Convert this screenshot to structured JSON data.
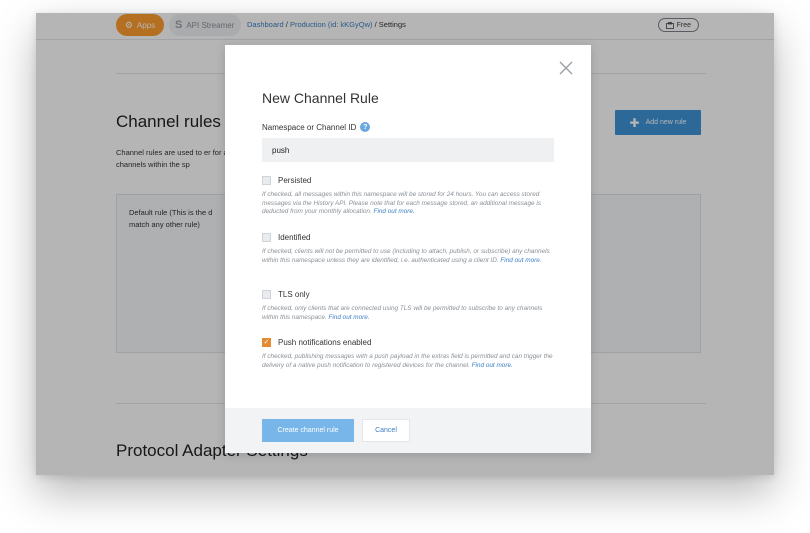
{
  "topbar": {
    "apps_label": "Apps",
    "streamer_icon": "S",
    "streamer_label": "API Streamer",
    "breadcrumb": {
      "dashboard": "Dashboard",
      "sep1": " / ",
      "app": "Production (id: kKGyQw)",
      "sep2": " / ",
      "current": "Settings"
    },
    "plan_label": "Free"
  },
  "page": {
    "channel_rules_title": "Channel rules",
    "channel_rules_desc": "Channel rules are used to er for all channels within the sp",
    "add_rule_label": "Add new rule",
    "default_rule_text": "Default rule (This is the d match any other rule)",
    "protocol_title": "Protocol Adapter Settings"
  },
  "modal": {
    "title": "New Channel Rule",
    "namespace_label": "Namespace or Channel ID",
    "help_glyph": "?",
    "namespace_value": "push",
    "options": [
      {
        "label": "Persisted",
        "checked": false,
        "help": "If checked, all messages within this namespace will be stored for 24 hours. You can access stored messages via the History API. Please note that for each message stored, an additional message is deducted from your monthly allocation.",
        "more": "Find out more."
      },
      {
        "label": "Identified",
        "checked": false,
        "help": "If checked, clients will not be permitted to use (including to attach, publish, or subscribe) any channels within this namespace unless they are identified, i.e. authenticated using a client ID.",
        "more": "Find out more."
      },
      {
        "label": "TLS only",
        "checked": false,
        "help": "If checked, only clients that are connected using TLS will be permitted to subscribe to any channels within this namespace.",
        "more": "Find out more."
      },
      {
        "label": "Push notifications enabled",
        "checked": true,
        "help": "If checked, publishing messages with a push payload in the extras field is permitted and can trigger the delivery of a native push notification to registered devices for the channel.",
        "more": "Find out more."
      }
    ],
    "checkmark": "✓",
    "create_label": "Create channel rule",
    "cancel_label": "Cancel"
  },
  "colors": {
    "apps_accent": "#ff9d2e",
    "primary_blue": "#3f95d8",
    "checkbox_checked": "#e38b32",
    "link": "#3b7fc4"
  },
  "icons": {
    "apps": "apps-gear-icon",
    "plan": "plan-badge-icon",
    "add": "plus-icon",
    "close": "close-icon",
    "help": "help-icon"
  }
}
